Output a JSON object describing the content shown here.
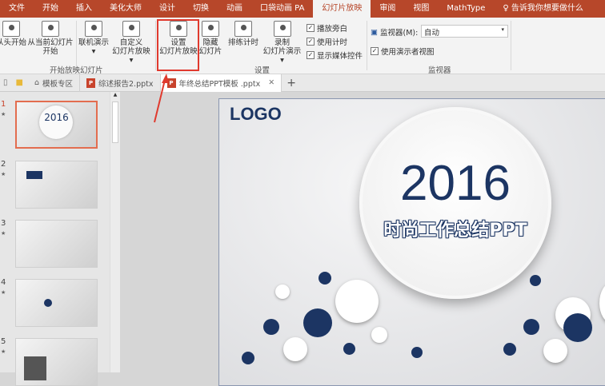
{
  "menu_tabs": [
    "文件",
    "开始",
    "插入",
    "美化大师",
    "设计",
    "切换",
    "动画",
    "口袋动画 PA",
    "幻灯片放映",
    "审阅",
    "视图",
    "MathType",
    "告诉我你想要做什么"
  ],
  "active_tab": "幻灯片放映",
  "ribbon": {
    "buttons": [
      {
        "label1": "从头开始",
        "label2": ""
      },
      {
        "label1": "从当前幻灯片",
        "label2": "开始"
      },
      {
        "label1": "联机演示",
        "label2": "▾"
      },
      {
        "label1": "自定义",
        "label2": "幻灯片放映 ▾"
      },
      {
        "label1": "设置",
        "label2": "幻灯片放映"
      },
      {
        "label1": "隐藏",
        "label2": "幻灯片"
      },
      {
        "label1": "排练计时",
        "label2": ""
      },
      {
        "label1": "录制",
        "label2": "幻灯片演示 ▾"
      }
    ],
    "checkboxes": [
      "播放旁白",
      "使用计时",
      "显示媒体控件"
    ],
    "monitor_label": "监视器(M):",
    "monitor_value": "自动",
    "presenter_view": "使用演示者视图",
    "groups": [
      "开始放映幻灯片",
      "设置",
      "监视器"
    ]
  },
  "doc_tabs": [
    {
      "label": "模板专区"
    },
    {
      "label": "综述报告2.pptx"
    },
    {
      "label": "年终总结PPT模板 .pptx",
      "active": true
    }
  ],
  "thumbnails": [
    {
      "num": "1"
    },
    {
      "num": "2"
    },
    {
      "num": "3"
    },
    {
      "num": "4"
    },
    {
      "num": "5"
    }
  ],
  "slide": {
    "logo": "LOGO",
    "year": "2016",
    "subtitle": "时尚工作总结PPT"
  },
  "colors": {
    "accent": "#b7472a",
    "navy": "#1c3563",
    "highlight": "#e03a2e"
  }
}
